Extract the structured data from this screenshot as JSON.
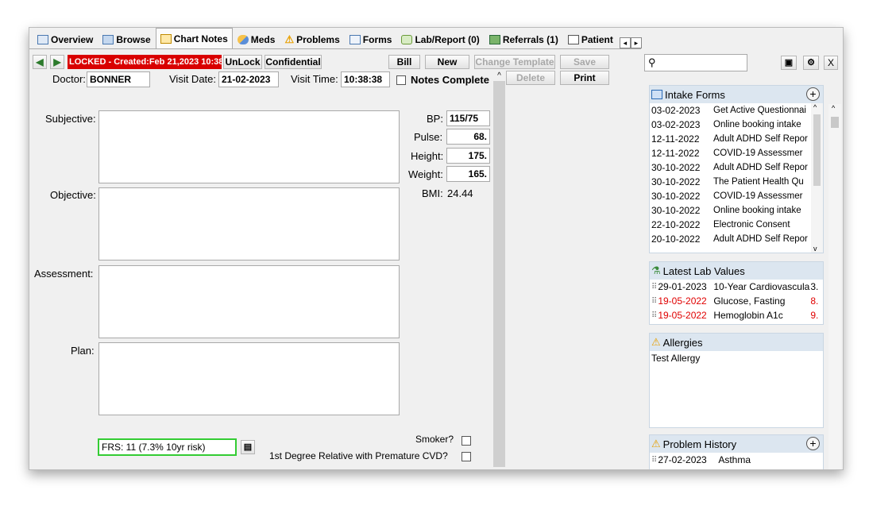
{
  "tabs": [
    {
      "label": "Overview",
      "icon": "overview-icon"
    },
    {
      "label": "Browse",
      "icon": "browse-icon"
    },
    {
      "label": "Chart Notes",
      "icon": "chart-notes-icon"
    },
    {
      "label": "Meds",
      "icon": "pill-icon"
    },
    {
      "label": "Problems",
      "icon": "warning-icon"
    },
    {
      "label": "Forms",
      "icon": "forms-icon"
    },
    {
      "label": "Lab/Report (0)",
      "icon": "lab-icon"
    },
    {
      "label": "Referrals (1)",
      "icon": "referrals-icon"
    },
    {
      "label": "Patient",
      "icon": "patient-icon"
    }
  ],
  "toolbar": {
    "locked_label": "LOCKED - Created:Feb 21,2023 10:38",
    "unlock_label": "UnLock",
    "confidential_label": "Confidential",
    "bill_label": "Bill",
    "new_label": "New",
    "change_template_label": "Change Template",
    "save_label": "Save",
    "delete_label": "Delete",
    "print_label": "Print"
  },
  "visit": {
    "doctor_label": "Doctor:",
    "doctor_value": "BONNER",
    "date_label": "Visit Date:",
    "date_value": "21-02-2023",
    "time_label": "Visit Time:",
    "time_value": "10:38:38",
    "notes_complete_label": "Notes Complete"
  },
  "soap": {
    "subjective": "Subjective:",
    "objective": "Objective:",
    "assessment": "Assessment:",
    "plan": "Plan:"
  },
  "vitals": {
    "bp_label": "BP:",
    "bp_value": "115/75",
    "pulse_label": "Pulse:",
    "pulse_value": "68.",
    "height_label": "Height:",
    "height_value": "175.",
    "weight_label": "Weight:",
    "weight_value": "165.",
    "bmi_label": "BMI:",
    "bmi_value": "24.44"
  },
  "risk": {
    "frs_value": "FRS: 11 (7.3% 10yr risk)",
    "smoker_label": "Smoker?",
    "relative_label": "1st Degree Relative with Premature CVD?"
  },
  "sidebar": {
    "close_label": "X",
    "intake": {
      "title": "Intake Forms",
      "rows": [
        {
          "date": "03-02-2023",
          "name": "Get Active Questionnai"
        },
        {
          "date": "03-02-2023",
          "name": "Online booking intake"
        },
        {
          "date": "12-11-2022",
          "name": "Adult ADHD Self Repor"
        },
        {
          "date": "12-11-2022",
          "name": "COVID-19 Assessmer"
        },
        {
          "date": "30-10-2022",
          "name": "Adult ADHD Self Repor"
        },
        {
          "date": "30-10-2022",
          "name": "The Patient Health Qu"
        },
        {
          "date": "30-10-2022",
          "name": "COVID-19 Assessmer"
        },
        {
          "date": "30-10-2022",
          "name": "Online booking intake"
        },
        {
          "date": "22-10-2022",
          "name": "Electronic Consent"
        },
        {
          "date": "20-10-2022",
          "name": "Adult ADHD Self Repor"
        }
      ]
    },
    "labs": {
      "title": "Latest Lab Values",
      "rows": [
        {
          "date": "29-01-2023",
          "name": "10-Year Cardiovascula",
          "value": "3.",
          "alert": false
        },
        {
          "date": "19-05-2022",
          "name": "Glucose, Fasting",
          "value": "8.",
          "alert": true
        },
        {
          "date": "19-05-2022",
          "name": "Hemoglobin A1c",
          "value": "9.",
          "alert": true
        }
      ]
    },
    "allergies": {
      "title": "Allergies",
      "rows": [
        "Test Allergy"
      ]
    },
    "problems": {
      "title": "Problem History",
      "rows": [
        {
          "date": "27-02-2023",
          "name": "Asthma"
        }
      ]
    }
  }
}
